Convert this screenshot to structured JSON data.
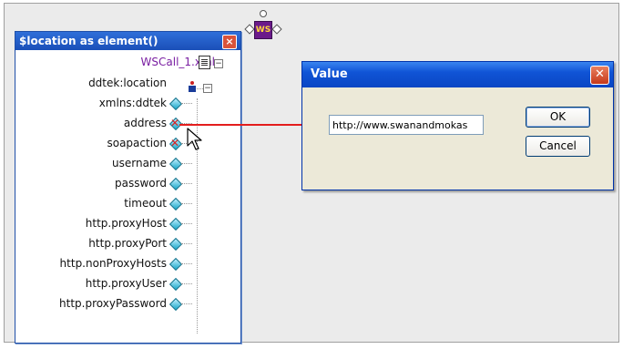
{
  "schema_panel": {
    "title": "$location as element()",
    "file_name": "WSCall_1.xml",
    "root_element": "ddtek:location",
    "children": [
      {
        "label": "xmlns:ddtek",
        "icon": "attribute-icon",
        "mapped": false
      },
      {
        "label": "address",
        "icon": "attribute-mapped-icon",
        "mapped": true
      },
      {
        "label": "soapaction",
        "icon": "attribute-mapped-icon",
        "mapped": true
      },
      {
        "label": "username",
        "icon": "attribute-icon",
        "mapped": false
      },
      {
        "label": "password",
        "icon": "attribute-icon",
        "mapped": false
      },
      {
        "label": "timeout",
        "icon": "attribute-icon",
        "mapped": false
      },
      {
        "label": "http.proxyHost",
        "icon": "attribute-icon",
        "mapped": false
      },
      {
        "label": "http.proxyPort",
        "icon": "attribute-icon",
        "mapped": false
      },
      {
        "label": "http.nonProxyHosts",
        "icon": "attribute-icon",
        "mapped": false
      },
      {
        "label": "http.proxyUser",
        "icon": "attribute-icon",
        "mapped": false
      },
      {
        "label": "http.proxyPassword",
        "icon": "attribute-icon",
        "mapped": false
      }
    ]
  },
  "ws_badge": {
    "label": "WS"
  },
  "dialog": {
    "title": "Value",
    "value": "http://www.swanandmokas",
    "ok_label": "OK",
    "cancel_label": "Cancel"
  },
  "colors": {
    "panel_title_bg": "#2f6fd9",
    "dialog_title_bg": "#1054d6",
    "connector": "#e31d1d",
    "file_name_text": "#7a1fa2"
  }
}
